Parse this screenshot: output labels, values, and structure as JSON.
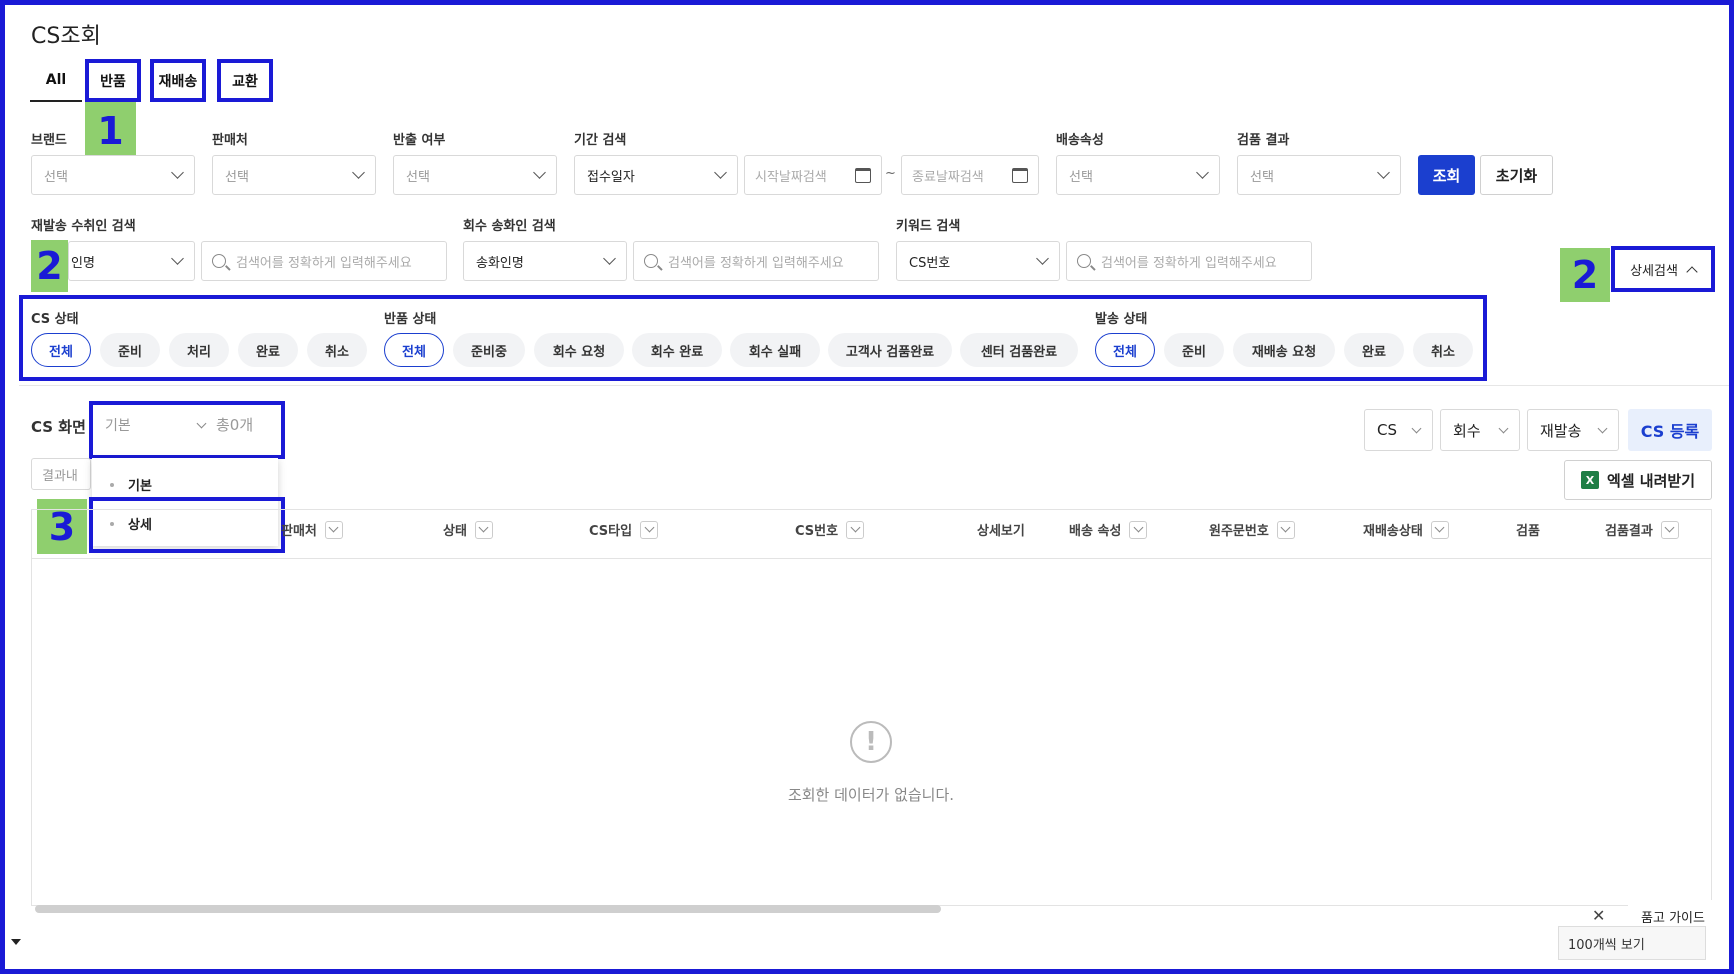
{
  "page": {
    "title": "CS조회"
  },
  "tabs": [
    {
      "label": "All",
      "active": true
    },
    {
      "label": "반품"
    },
    {
      "label": "재배송"
    },
    {
      "label": "교환"
    }
  ],
  "annotations": {
    "badge1": "1",
    "badge2": "2",
    "badge3": "3"
  },
  "filters": {
    "brand": {
      "label": "브랜드",
      "value": "선택"
    },
    "seller": {
      "label": "판매처",
      "value": "선택"
    },
    "export": {
      "label": "반출 여부",
      "value": "선택"
    },
    "period": {
      "label": "기간 검색",
      "type": "접수일자",
      "start_placeholder": "시작날짜검색",
      "end_placeholder": "종료날짜검색",
      "separator": "~"
    },
    "shipping": {
      "label": "배송속성",
      "value": "선택"
    },
    "inspection": {
      "label": "검품 결과",
      "value": "선택"
    },
    "search_button": "조회",
    "reset_button": "초기화",
    "resend": {
      "label": "재발송 수취인 검색",
      "type": "수취인명",
      "type_visible": "인명",
      "placeholder": "검색어를 정확하게 입력해주세요"
    },
    "pickup": {
      "label": "회수 송화인 검색",
      "type": "송화인명",
      "placeholder": "검색어를 정확하게 입력해주세요"
    },
    "keyword": {
      "label": "키워드 검색",
      "type": "CS번호",
      "placeholder": "검색어를 정확하게 입력해주세요"
    },
    "detail_search": "상세검색"
  },
  "status": {
    "cs": {
      "label": "CS 상태",
      "options": [
        "전체",
        "준비",
        "처리",
        "완료",
        "취소"
      ],
      "selected": "전체"
    },
    "return": {
      "label": "반품 상태",
      "options": [
        "전체",
        "준비중",
        "회수 요청",
        "회수 완료",
        "회수 실패",
        "고객사 검품완료",
        "센터 검품완료"
      ],
      "selected": "전체"
    },
    "shipment": {
      "label": "발송 상태",
      "options": [
        "전체",
        "준비",
        "재배송 요청",
        "완료",
        "취소"
      ],
      "selected": "전체"
    }
  },
  "results": {
    "label": "CS 화면",
    "view": "기본",
    "count": "총0개",
    "view_options": [
      "기본",
      "상세"
    ],
    "search_within_placeholder": "결과내",
    "selects": [
      "CS",
      "회수",
      "재발송"
    ],
    "register_button": "CS 등록",
    "excel_button": "엑셀 내려받기",
    "columns": [
      "판매처",
      "상태",
      "CS타입",
      "CS번호",
      "상세보기",
      "배송 속성",
      "원주문번호",
      "재배송상태",
      "검품",
      "검품결과"
    ],
    "empty_message": "조회한 데이터가 없습니다.",
    "page_size": "100개씩 보기",
    "guide": "품고 가이드"
  }
}
